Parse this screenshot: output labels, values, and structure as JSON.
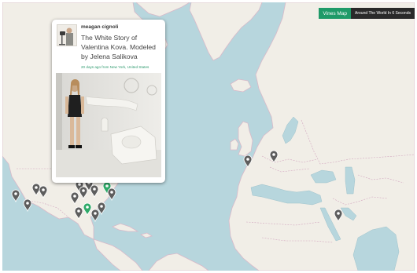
{
  "tabs": {
    "active_label": "Vines Map",
    "other_label": "Around The World In 6 Seconds"
  },
  "popup": {
    "username": "meagan cignoli",
    "caption": "The White Story of Valentina Kova. Modeled by Jelena Salikova",
    "meta": "20 days ago from New York, United States"
  },
  "map": {
    "water_color": "#b7d6dd",
    "land_color": "#f1eee7",
    "marker_color": "#5d5d5d",
    "active_marker_color": "#2ea968",
    "markers": [
      {
        "name": "map-marker-europe-west",
        "active": false
      },
      {
        "name": "map-marker-europe-central",
        "active": false
      },
      {
        "name": "map-marker-middle-east",
        "active": false
      },
      {
        "name": "map-marker-us-west-1",
        "active": false
      },
      {
        "name": "map-marker-us-west-2",
        "active": false
      },
      {
        "name": "map-marker-us-rockies-1",
        "active": false
      },
      {
        "name": "map-marker-us-rockies-2",
        "active": false
      },
      {
        "name": "map-marker-us-midwest-1",
        "active": false
      },
      {
        "name": "map-marker-us-midwest-2",
        "active": false
      },
      {
        "name": "map-marker-us-midwest-3",
        "active": false
      },
      {
        "name": "map-marker-us-great-lakes",
        "active": false
      },
      {
        "name": "map-marker-us-northeast-1",
        "active": false
      },
      {
        "name": "map-marker-new-york",
        "active": true
      },
      {
        "name": "map-marker-us-east-2",
        "active": false
      },
      {
        "name": "map-marker-us-south-1",
        "active": false
      },
      {
        "name": "map-marker-us-south-2",
        "active": false
      },
      {
        "name": "map-marker-us-south-3",
        "active": false
      },
      {
        "name": "map-marker-florida",
        "active": true
      }
    ]
  }
}
